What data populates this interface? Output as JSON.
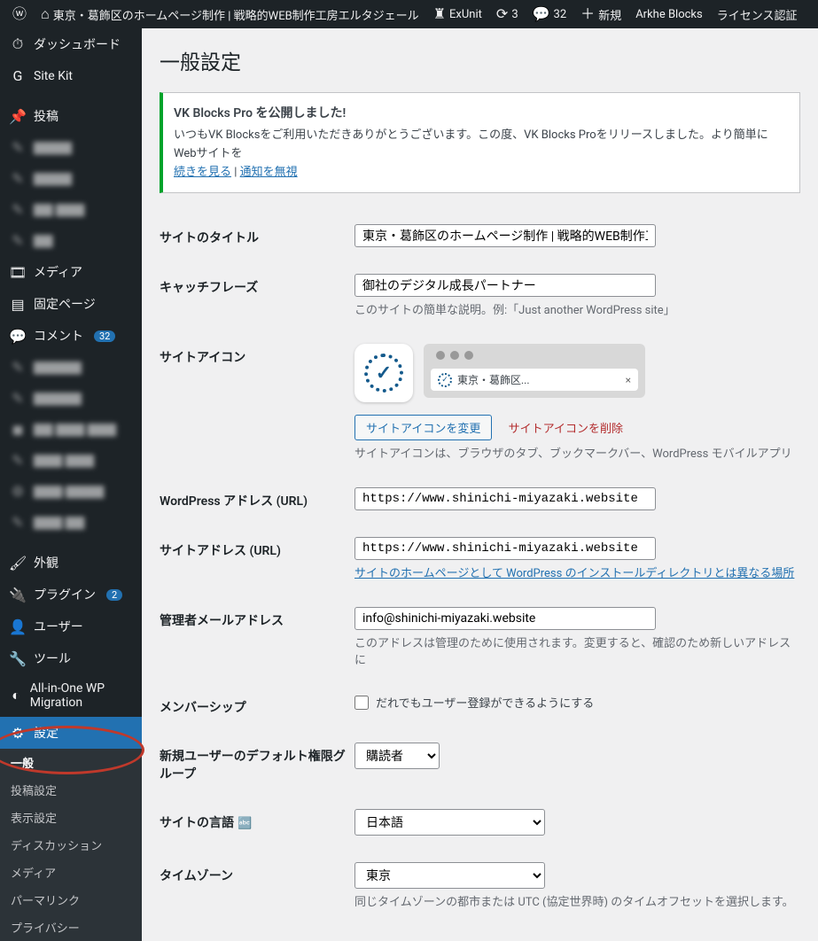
{
  "adminbar": {
    "site_name": "東京・葛飾区のホームページ制作 | 戦略的WEB制作工房エルタジェール",
    "exunit": "ExUnit",
    "updates": "3",
    "comments": "32",
    "new": "新規",
    "arkhe": "Arkhe Blocks",
    "license": "ライセンス認証"
  },
  "sidebar": {
    "dashboard": "ダッシュボード",
    "sitekit": "Site Kit",
    "posts": "投稿",
    "media": "メディア",
    "pages": "固定ページ",
    "comments": "コメント",
    "comments_count": "32",
    "appearance": "外観",
    "plugins": "プラグイン",
    "plugins_count": "2",
    "users": "ユーザー",
    "tools": "ツール",
    "aio": "All-in-One WP Migration",
    "settings": "設定",
    "sub": {
      "general": "一般",
      "writing": "投稿設定",
      "reading": "表示設定",
      "discussion": "ディスカッション",
      "media": "メディア",
      "permalink": "パーマリンク",
      "privacy": "プライバシー"
    }
  },
  "page": {
    "title": "一般設定"
  },
  "notice": {
    "title": "VK Blocks Pro を公開しました!",
    "body": "いつもVK Blocksをご利用いただきありがとうございます。この度、VK Blocks Proをリリースしました。より簡単にWebサイトを",
    "more": "続きを見る",
    "dismiss": "通知を無視"
  },
  "form": {
    "site_title_label": "サイトのタイトル",
    "site_title_value": "東京・葛飾区のホームページ制作 | 戦略的WEB制作工",
    "tagline_label": "キャッチフレーズ",
    "tagline_value": "御社のデジタル成長パートナー",
    "tagline_desc": "このサイトの簡単な説明。例:「Just another WordPress site」",
    "icon_label": "サイトアイコン",
    "icon_tab_text": "東京・葛飾区...",
    "icon_change": "サイトアイコンを変更",
    "icon_remove": "サイトアイコンを削除",
    "icon_desc": "サイトアイコンは、ブラウザのタブ、ブックマークバー、WordPress モバイルアプリ",
    "wpurl_label": "WordPress アドレス (URL)",
    "wpurl_value": "https://www.shinichi-miyazaki.website",
    "siteurl_label": "サイトアドレス (URL)",
    "siteurl_value": "https://www.shinichi-miyazaki.website",
    "siteurl_desc": "サイトのホームページとして WordPress のインストールディレクトリとは異なる場所",
    "admin_email_label": "管理者メールアドレス",
    "admin_email_value": "info@shinichi-miyazaki.website",
    "admin_email_desc": "このアドレスは管理のために使用されます。変更すると、確認のため新しいアドレスに",
    "membership_label": "メンバーシップ",
    "membership_check": "だれでもユーザー登録ができるようにする",
    "default_role_label": "新規ユーザーのデフォルト権限グループ",
    "default_role_value": "購読者",
    "lang_label": "サイトの言語",
    "lang_value": "日本語",
    "tz_label": "タイムゾーン",
    "tz_value": "東京",
    "tz_desc": "同じタイムゾーンの都市または UTC (協定世界時) のタイムオフセットを選択します。"
  }
}
